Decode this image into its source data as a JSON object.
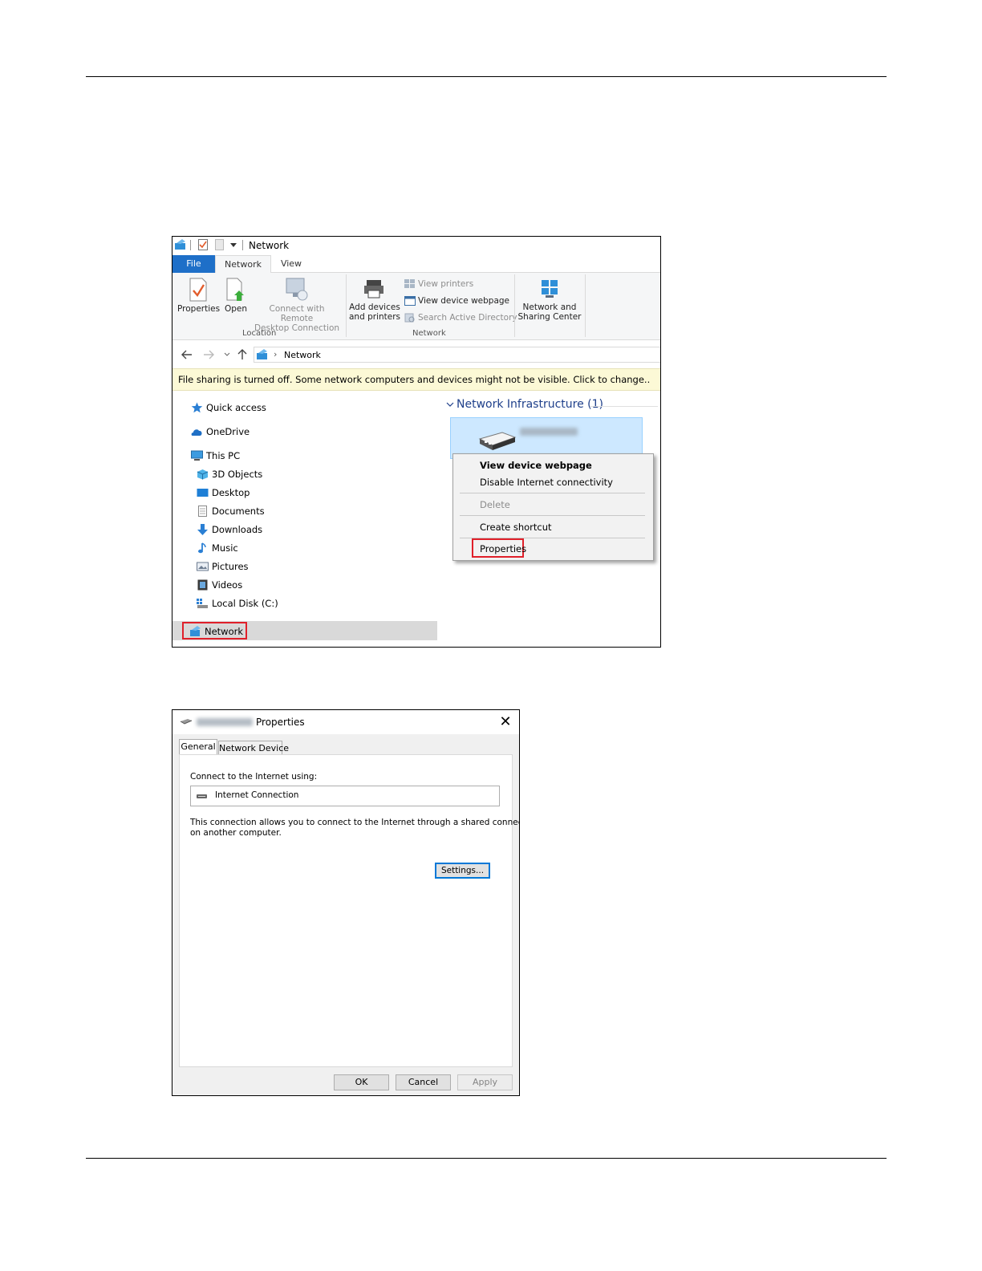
{
  "explorer": {
    "window_title": "Network",
    "tabs": {
      "file": "File",
      "network": "Network",
      "view": "View"
    },
    "ribbon": {
      "properties": "Properties",
      "open": "Open",
      "connect_remote_line1": "Connect with Remote",
      "connect_remote_line2": "Desktop Connection",
      "location_group": "Location",
      "add_devices_line1": "Add devices",
      "add_devices_line2": "and printers",
      "view_printers": "View printers",
      "view_device_webpage": "View device webpage",
      "search_ad": "Search Active Directory",
      "network_group": "Network",
      "nsc_line1": "Network and",
      "nsc_line2": "Sharing Center"
    },
    "address": {
      "breadcrumb_sep": "›",
      "location": "Network"
    },
    "infobar": "File sharing is turned off. Some network computers and devices might not be visible. Click to change..",
    "nav": {
      "quick_access": "Quick access",
      "onedrive": "OneDrive",
      "this_pc": "This PC",
      "objects3d": "3D Objects",
      "desktop": "Desktop",
      "documents": "Documents",
      "downloads": "Downloads",
      "music": "Music",
      "pictures": "Pictures",
      "videos": "Videos",
      "local_disk": "Local Disk (C:)",
      "network": "Network"
    },
    "content": {
      "group_header": "Network Infrastructure (1)"
    },
    "context_menu": {
      "view_webpage": "View device webpage",
      "disable_internet": "Disable Internet connectivity",
      "delete": "Delete",
      "create_shortcut": "Create shortcut",
      "properties": "Properties"
    },
    "colors": {
      "highlight": "#e0202a",
      "file_tab": "#1e6fc8",
      "tile": "#cde8ff"
    }
  },
  "dialog": {
    "title": "Properties",
    "tab_general": "General",
    "tab_network_device": "Network Device",
    "connect_label": "Connect to the Internet using:",
    "connection_name": "Internet Connection",
    "desc_line1": "This connection allows you to connect to the Internet through a shared connection",
    "desc_line2": "on another computer.",
    "settings": "Settings...",
    "ok": "OK",
    "cancel": "Cancel",
    "apply": "Apply",
    "close_glyph": "✕"
  }
}
